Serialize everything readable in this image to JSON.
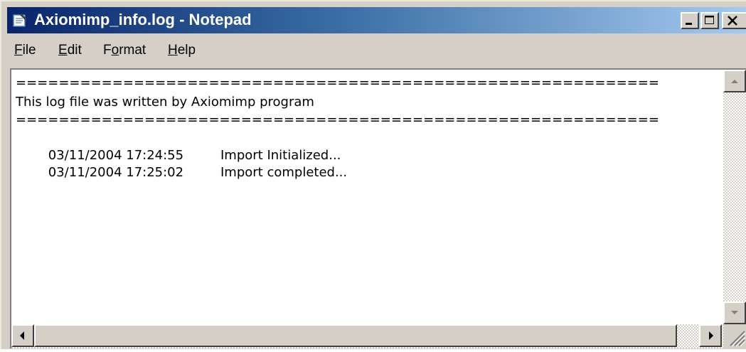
{
  "window": {
    "title": "Axiomimp_info.log - Notepad",
    "icons": {
      "app": "notepad-icon",
      "minimize": "minimize-icon",
      "maximize": "maximize-icon",
      "close": "close-icon"
    }
  },
  "menu": {
    "file": {
      "acc": "F",
      "rest": "ile"
    },
    "edit": {
      "acc": "E",
      "rest": "dit"
    },
    "format": {
      "pre": "F",
      "acc": "o",
      "rest": "rmat"
    },
    "help": {
      "acc": "H",
      "rest": "elp"
    }
  },
  "document": {
    "separator": "============================================================",
    "header_text": "This log file was written by Axiomimp program",
    "entries": [
      {
        "timestamp": "03/11/2004 17:24:55",
        "message": "Import Initialized..."
      },
      {
        "timestamp": "03/11/2004 17:25:02",
        "message": "Import completed..."
      }
    ]
  },
  "colors": {
    "titlebar_start": "#0a246a",
    "titlebar_end": "#a6caf0",
    "face": "#d4d0c8"
  }
}
